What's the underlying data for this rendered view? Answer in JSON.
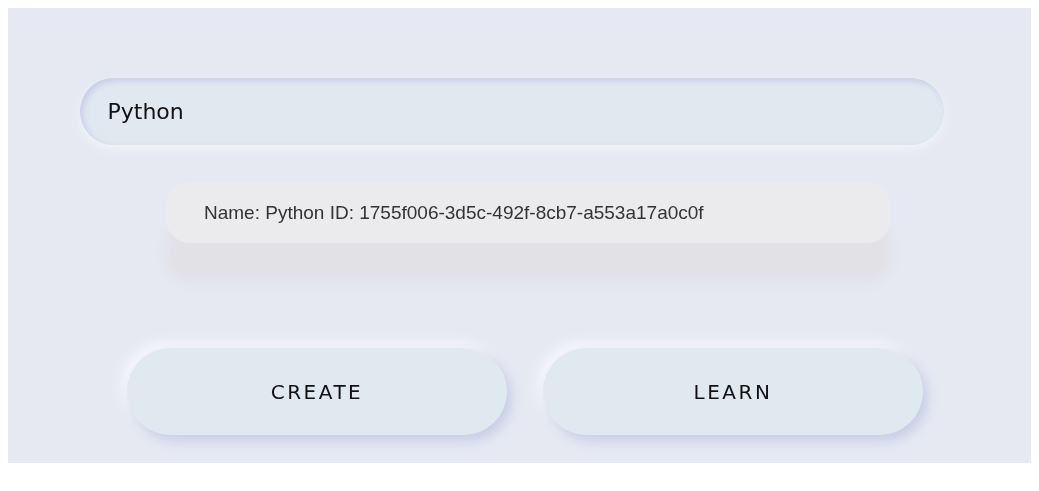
{
  "search": {
    "value": "Python"
  },
  "result": {
    "text": "Name: Python ID: 1755f006-3d5c-492f-8cb7-a553a17a0c0f"
  },
  "buttons": [
    {
      "label": "CREATE"
    },
    {
      "label": "LEARN"
    }
  ]
}
